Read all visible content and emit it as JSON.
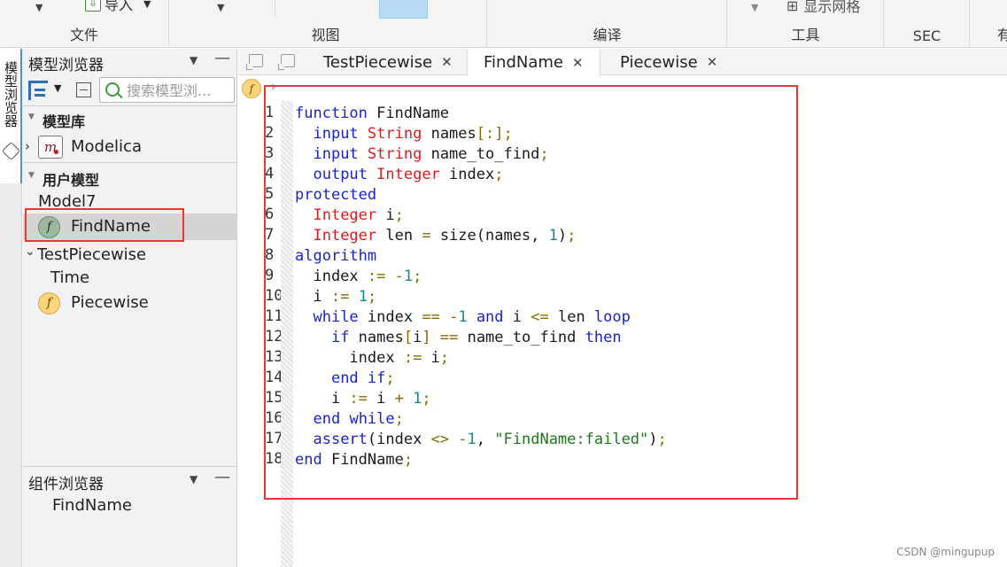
{
  "ribbon": {
    "import_label": "导入",
    "groups": [
      "文件",
      "视图",
      "编译",
      "工具",
      "SEC",
      "有"
    ],
    "show_grid_label": "显示网格"
  },
  "sidetab": {
    "label": "模型浏览器"
  },
  "model_browser": {
    "title": "模型浏览器",
    "search_placeholder": "搜索模型浏...",
    "library_section": "模型库",
    "library_items": [
      {
        "label": "Modelica"
      }
    ],
    "user_section": "用户模型",
    "user_items": [
      {
        "label": "Model7"
      },
      {
        "label": "FindName",
        "icon": "f",
        "selected": true
      },
      {
        "label": "TestPiecewise",
        "expanded": true
      },
      {
        "label": "Time"
      },
      {
        "label": "Piecewise",
        "icon": "f"
      }
    ]
  },
  "component_browser": {
    "title": "组件浏览器",
    "item": "FindName"
  },
  "editor": {
    "tabs": [
      {
        "label": "TestPiecewise",
        "active": false
      },
      {
        "label": "FindName",
        "active": true
      },
      {
        "label": "Piecewise",
        "active": false
      }
    ],
    "info_icon": "f",
    "line_numbers": [
      "1",
      "2",
      "3",
      "4",
      "5",
      "6",
      "7",
      "8",
      "9",
      "10",
      "11",
      "12",
      "13",
      "14",
      "15",
      "16",
      "17",
      "18"
    ],
    "code_lines": [
      "function FindName",
      "  input String names[:];",
      "  input String name_to_find;",
      "  output Integer index;",
      "protected",
      "  Integer i;",
      "  Integer len = size(names, 1);",
      "algorithm",
      "  index := -1;",
      "  i := 1;",
      "  while index == -1 and i <= len loop",
      "    if names[i] == name_to_find then",
      "      index := i;",
      "    end if;",
      "    i := i + 1;",
      "  end while;",
      "  assert(index <> -1, \"FindName:failed\");",
      "end FindName;"
    ]
  },
  "watermark": "CSDN @mingupup",
  "colors": {
    "keyword": "#1a24c8",
    "type": "#d81e1e",
    "number": "#158a8a",
    "string": "#1a7a1a",
    "highlight_box": "#e53935",
    "selection": "#d4d4d4"
  }
}
